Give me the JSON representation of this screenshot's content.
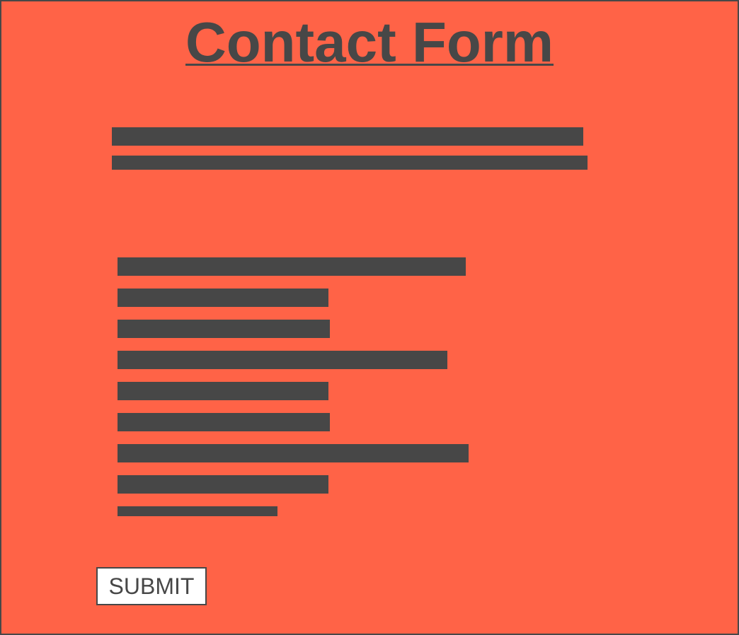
{
  "form": {
    "title": "Contact Form",
    "submit_label": "SUBMIT"
  },
  "colors": {
    "background": "#ff6347",
    "foreground": "#474747",
    "button_background": "#ffffff"
  }
}
